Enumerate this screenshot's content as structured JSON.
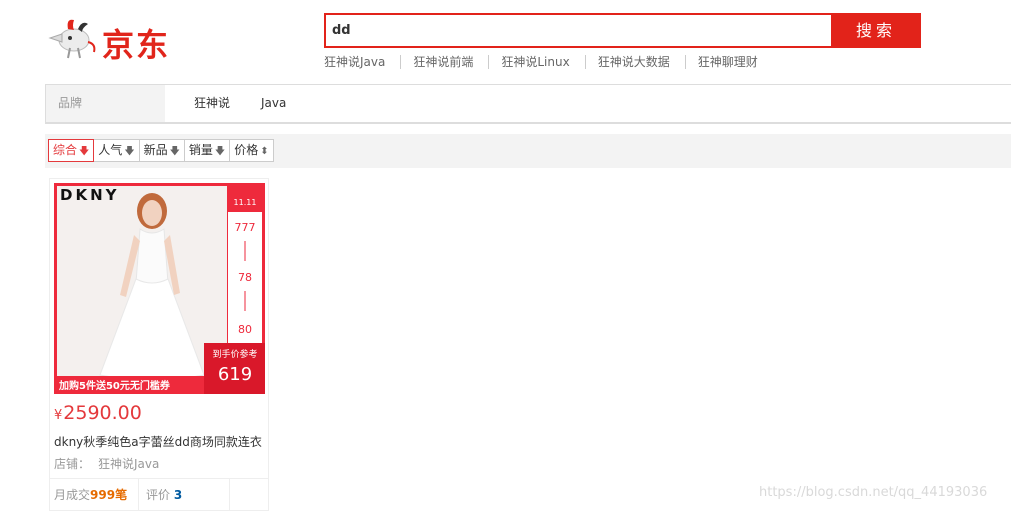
{
  "header": {
    "logo_text": "京东",
    "search_value": "dd",
    "search_button": "搜索",
    "hotwords": [
      "狂神说Java",
      "狂神说前端",
      "狂神说Linux",
      "狂神说大数据",
      "狂神聊理财"
    ]
  },
  "filter": {
    "brand_label": "品牌",
    "brand_values": [
      "狂神说",
      "Java"
    ]
  },
  "sort": {
    "items": [
      {
        "label": "综合",
        "arrow": "🡇"
      },
      {
        "label": "人气",
        "arrow": "🡇"
      },
      {
        "label": "新品",
        "arrow": "🡇"
      },
      {
        "label": "销量",
        "arrow": "🡇"
      },
      {
        "label": "价格",
        "arrow": "⬍"
      }
    ]
  },
  "product": {
    "image": {
      "brand_text": "DKNY",
      "promo_text": "加购5件送50元无门槛券",
      "badge_text": "到手价参考",
      "badge_price": "619",
      "side_prices": [
        "777",
        "78",
        "80"
      ],
      "yen": "¥"
    },
    "price_symbol": "¥",
    "price": "2590.00",
    "title": "dkny秋季纯色a字蕾丝dd商场同款连衣",
    "shop_label": "店铺：",
    "shop_name": "狂神说Java",
    "sales_label": "月成交",
    "sales_value": "999笔",
    "review_label": "评价",
    "review_value": "3"
  },
  "watermark": "https://blog.csdn.net/qq_44193036",
  "colors": {
    "jd_red": "#e2231a",
    "price_red": "#e4393c",
    "orange": "#e66b00",
    "link_blue": "#005aa0"
  }
}
